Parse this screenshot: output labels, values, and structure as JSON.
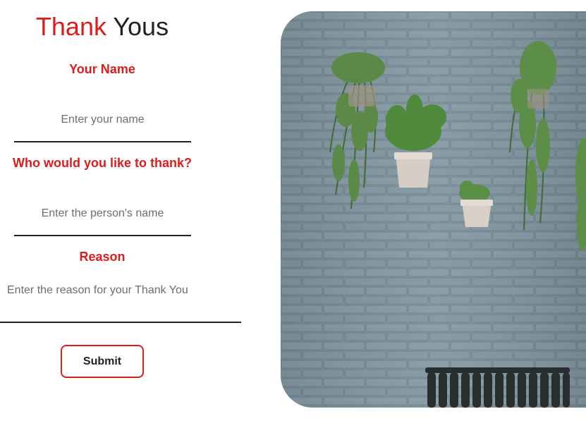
{
  "title": {
    "part1": "Thank",
    "part2": " Yous"
  },
  "form": {
    "name_label": "Your Name",
    "name_placeholder": "Enter your name",
    "thank_label": "Who would you like to thank?",
    "thank_placeholder": "Enter the person's name",
    "reason_label": "Reason",
    "reason_placeholder": "Enter the reason for your Thank You",
    "submit_label": "Submit"
  },
  "colors": {
    "accent": "#dd1c1c",
    "text": "#222222",
    "wall": "#7e929c"
  },
  "image": {
    "subject": "plants-on-brick-wall-photo"
  }
}
